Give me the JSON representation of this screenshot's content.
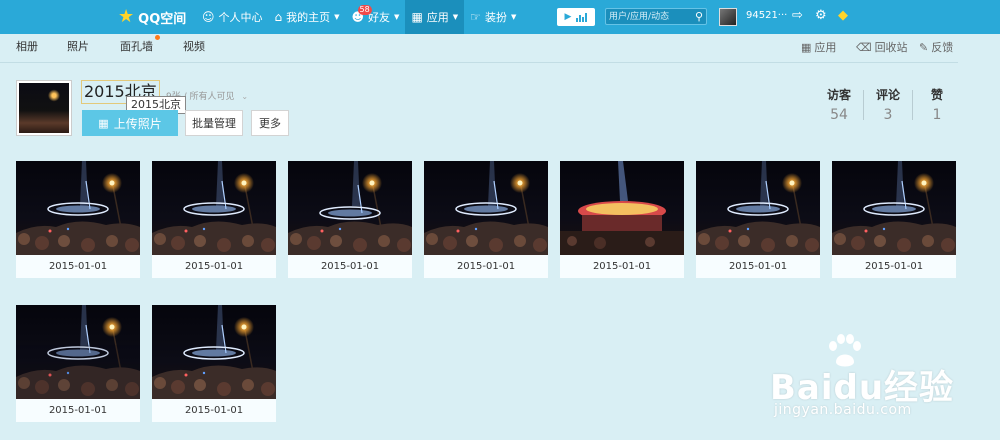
{
  "topbar": {
    "logo_text": "QQ空间",
    "nav": [
      {
        "label": "个人中心",
        "icon": "user-icon",
        "caret": false
      },
      {
        "label": "我的主页",
        "icon": "home-icon",
        "caret": true
      },
      {
        "label": "好友",
        "icon": "friends-icon",
        "caret": true,
        "badge": "58"
      },
      {
        "label": "应用",
        "icon": "grid-icon",
        "caret": true,
        "active": true
      },
      {
        "label": "装扮",
        "icon": "shirt-icon",
        "caret": true
      }
    ],
    "search_placeholder": "用户/应用/动态",
    "username": "94521···",
    "colors": {
      "bar": "#2aa9d8",
      "active": "#1b8fbc",
      "badge": "#f04a4a"
    }
  },
  "tabs": [
    "相册",
    "照片",
    "面孔墙",
    "视频"
  ],
  "tools": {
    "apps": "应用",
    "recycle": "回收站",
    "feedback": "反馈"
  },
  "album": {
    "title": "2015北京",
    "tooltip": "2015北京",
    "count": "9张",
    "privacy": "所有人可见",
    "upload_label": "上传照片",
    "batch_label": "批量管理",
    "more_label": "更多"
  },
  "stats": [
    {
      "label": "访客",
      "value": "54"
    },
    {
      "label": "评论",
      "value": "3"
    },
    {
      "label": "赞",
      "value": "1"
    }
  ],
  "photos": [
    {
      "date": "2015-01-01",
      "variant": "a"
    },
    {
      "date": "2015-01-01",
      "variant": "b"
    },
    {
      "date": "2015-01-01",
      "variant": "c"
    },
    {
      "date": "2015-01-01",
      "variant": "a"
    },
    {
      "date": "2015-01-01",
      "variant": "d"
    },
    {
      "date": "2015-01-01",
      "variant": "a"
    },
    {
      "date": "2015-01-01",
      "variant": "b"
    },
    {
      "date": "2015-01-01",
      "variant": "e"
    },
    {
      "date": "2015-01-01",
      "variant": "b"
    }
  ],
  "watermark": {
    "brand": "Baidu经验",
    "url": "jingyan.baidu.com"
  }
}
